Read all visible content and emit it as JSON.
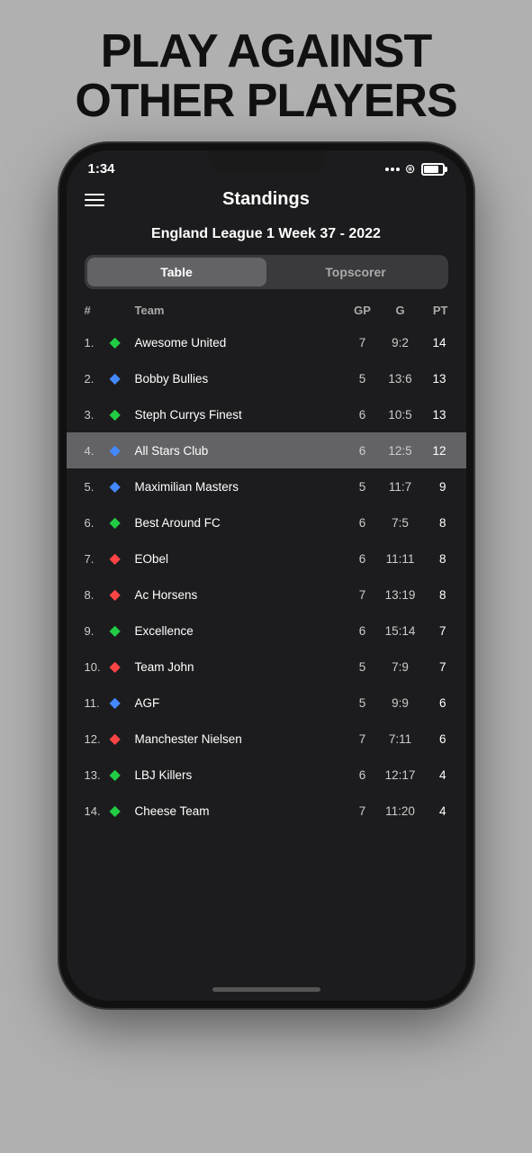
{
  "headline": {
    "line1": "PLAY AGAINST",
    "line2": "OTHER PLAYERS"
  },
  "status": {
    "time": "1:34",
    "battery_level": "80"
  },
  "header": {
    "title": "Standings"
  },
  "league": {
    "title": "England League 1 Week 37 - 2022"
  },
  "tabs": [
    {
      "label": "Table",
      "active": true
    },
    {
      "label": "Topscorer",
      "active": false
    }
  ],
  "table_header": {
    "rank": "#",
    "team": "Team",
    "gp": "GP",
    "g": "G",
    "pt": "PT"
  },
  "rows": [
    {
      "rank": "1.",
      "team": "Awesome United",
      "shirt_color": "green",
      "gp": "7",
      "g": "9:2",
      "pt": "14",
      "highlighted": false
    },
    {
      "rank": "2.",
      "team": "Bobby Bullies",
      "shirt_color": "blue",
      "gp": "5",
      "g": "13:6",
      "pt": "13",
      "highlighted": false
    },
    {
      "rank": "3.",
      "team": "Steph Currys Finest",
      "shirt_color": "green",
      "gp": "6",
      "g": "10:5",
      "pt": "13",
      "highlighted": false
    },
    {
      "rank": "4.",
      "team": "All Stars Club",
      "shirt_color": "blue",
      "gp": "6",
      "g": "12:5",
      "pt": "12",
      "highlighted": true
    },
    {
      "rank": "5.",
      "team": "Maximilian Masters",
      "shirt_color": "blue",
      "gp": "5",
      "g": "11:7",
      "pt": "9",
      "highlighted": false
    },
    {
      "rank": "6.",
      "team": "Best Around FC",
      "shirt_color": "green",
      "gp": "6",
      "g": "7:5",
      "pt": "8",
      "highlighted": false
    },
    {
      "rank": "7.",
      "team": "EObel",
      "shirt_color": "red",
      "gp": "6",
      "g": "11:11",
      "pt": "8",
      "highlighted": false
    },
    {
      "rank": "8.",
      "team": "Ac Horsens",
      "shirt_color": "red",
      "gp": "7",
      "g": "13:19",
      "pt": "8",
      "highlighted": false
    },
    {
      "rank": "9.",
      "team": "Excellence",
      "shirt_color": "green",
      "gp": "6",
      "g": "15:14",
      "pt": "7",
      "highlighted": false
    },
    {
      "rank": "10.",
      "team": "Team John",
      "shirt_color": "red",
      "gp": "5",
      "g": "7:9",
      "pt": "7",
      "highlighted": false
    },
    {
      "rank": "11.",
      "team": "AGF",
      "shirt_color": "blue",
      "gp": "5",
      "g": "9:9",
      "pt": "6",
      "highlighted": false
    },
    {
      "rank": "12.",
      "team": "Manchester Nielsen",
      "shirt_color": "red",
      "gp": "7",
      "g": "7:11",
      "pt": "6",
      "highlighted": false
    },
    {
      "rank": "13.",
      "team": "LBJ Killers",
      "shirt_color": "green",
      "gp": "6",
      "g": "12:17",
      "pt": "4",
      "highlighted": false
    },
    {
      "rank": "14.",
      "team": "Cheese Team",
      "shirt_color": "green",
      "gp": "7",
      "g": "11:20",
      "pt": "4",
      "highlighted": false
    }
  ]
}
